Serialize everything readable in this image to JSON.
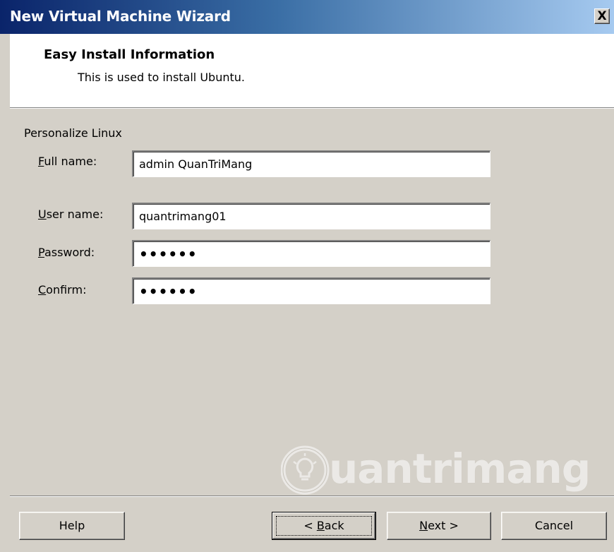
{
  "window": {
    "title": "New Virtual Machine Wizard",
    "close_label": "X"
  },
  "header": {
    "title": "Easy Install Information",
    "subtitle": "This is used to install Ubuntu."
  },
  "section": {
    "label": "Personalize Linux"
  },
  "fields": {
    "full_name": {
      "mnemonic": "F",
      "rest": "ull name:",
      "value": "admin QuanTriMang"
    },
    "user_name": {
      "mnemonic": "U",
      "rest": "ser name:",
      "value": "quantrimang01"
    },
    "password": {
      "mnemonic": "P",
      "rest": "assword:",
      "value": "••••••"
    },
    "confirm": {
      "mnemonic": "C",
      "rest": "onfirm:",
      "value": "••••••"
    }
  },
  "buttons": {
    "help": {
      "label": "Help"
    },
    "back": {
      "prefix": "< ",
      "mnemonic": "B",
      "rest": "ack"
    },
    "next": {
      "mnemonic": "N",
      "rest": "ext >"
    },
    "cancel": {
      "label": "Cancel"
    }
  },
  "watermark": {
    "text": "uantrimang"
  },
  "colors": {
    "titlebar_start": "#0a246a",
    "titlebar_end": "#a6caf0",
    "dialog_bg": "#d4d0c8"
  }
}
